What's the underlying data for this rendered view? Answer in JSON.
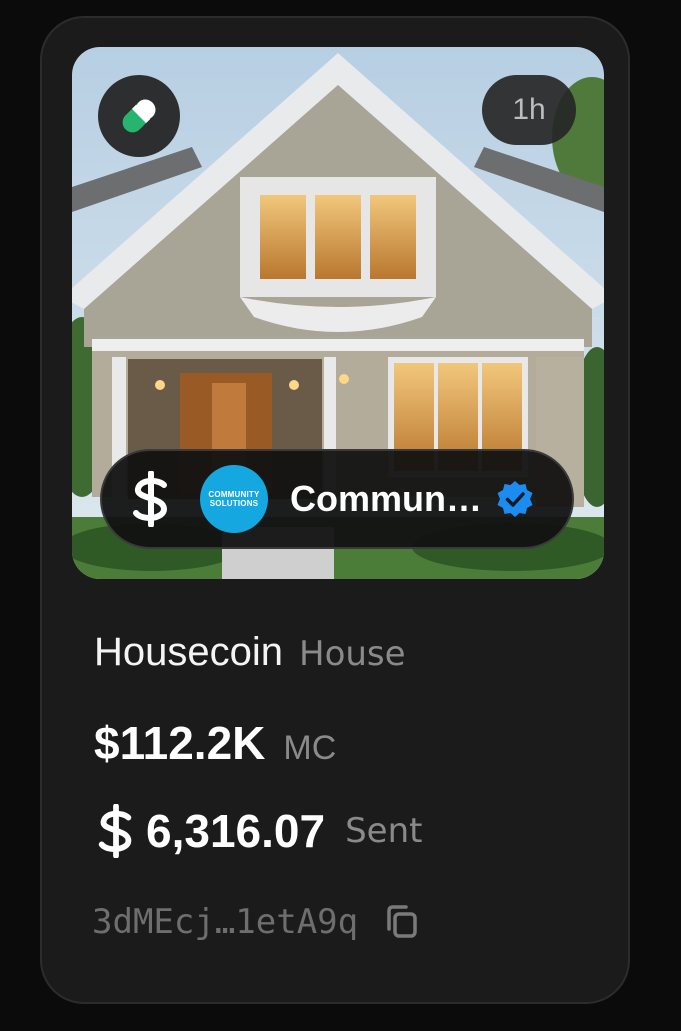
{
  "card": {
    "age": "1h",
    "pill_icon": "pill-icon",
    "creator": {
      "currency_icon": "dollar-coin-icon",
      "org_logo_line1": "COMMUNITY",
      "org_logo_line2": "SOLUTIONS",
      "name": "Commun…",
      "verified_icon": "verified-badge-icon"
    },
    "token_name": "Housecoin",
    "token_ticker": "House",
    "market_cap": "$112.2K",
    "market_cap_label": "MC",
    "sent_value": "6,316.07",
    "sent_label": "Sent",
    "address": "3dMEcj…1etA9q",
    "copy_icon": "copy-icon"
  },
  "colors": {
    "card_bg": "#1b1b1b",
    "pill_green": "#27b46e",
    "verified_blue": "#1d8cf0",
    "logo_blue": "#15a7e0"
  }
}
